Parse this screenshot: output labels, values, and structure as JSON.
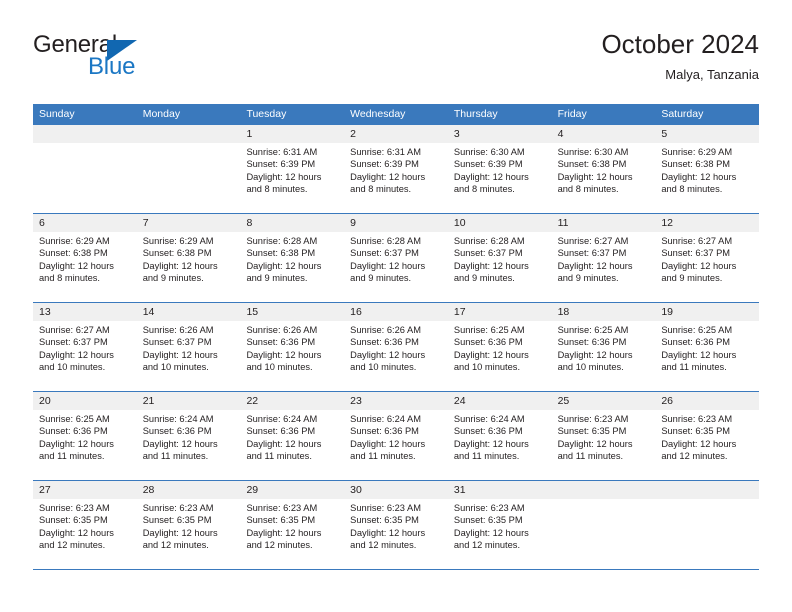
{
  "brand": {
    "name_top": "General",
    "name_bottom": "Blue",
    "top_color": "#231f20",
    "bottom_color": "#1b77c4",
    "triangle_color": "#1167b1"
  },
  "header": {
    "title": "October 2024",
    "subtitle": "Malya, Tanzania"
  },
  "theme": {
    "header_blue": "#3a79bd",
    "daterow_gray": "#f0f0f0",
    "text": "#231f20",
    "header_text": "#ffffff"
  },
  "weekdays": [
    "Sunday",
    "Monday",
    "Tuesday",
    "Wednesday",
    "Thursday",
    "Friday",
    "Saturday"
  ],
  "weeks": [
    {
      "days": [
        {
          "num": "",
          "sunrise": "",
          "sunset": "",
          "daylight1": "",
          "daylight2": ""
        },
        {
          "num": "",
          "sunrise": "",
          "sunset": "",
          "daylight1": "",
          "daylight2": ""
        },
        {
          "num": "1",
          "sunrise": "Sunrise: 6:31 AM",
          "sunset": "Sunset: 6:39 PM",
          "daylight1": "Daylight: 12 hours",
          "daylight2": "and 8 minutes."
        },
        {
          "num": "2",
          "sunrise": "Sunrise: 6:31 AM",
          "sunset": "Sunset: 6:39 PM",
          "daylight1": "Daylight: 12 hours",
          "daylight2": "and 8 minutes."
        },
        {
          "num": "3",
          "sunrise": "Sunrise: 6:30 AM",
          "sunset": "Sunset: 6:39 PM",
          "daylight1": "Daylight: 12 hours",
          "daylight2": "and 8 minutes."
        },
        {
          "num": "4",
          "sunrise": "Sunrise: 6:30 AM",
          "sunset": "Sunset: 6:38 PM",
          "daylight1": "Daylight: 12 hours",
          "daylight2": "and 8 minutes."
        },
        {
          "num": "5",
          "sunrise": "Sunrise: 6:29 AM",
          "sunset": "Sunset: 6:38 PM",
          "daylight1": "Daylight: 12 hours",
          "daylight2": "and 8 minutes."
        }
      ]
    },
    {
      "days": [
        {
          "num": "6",
          "sunrise": "Sunrise: 6:29 AM",
          "sunset": "Sunset: 6:38 PM",
          "daylight1": "Daylight: 12 hours",
          "daylight2": "and 8 minutes."
        },
        {
          "num": "7",
          "sunrise": "Sunrise: 6:29 AM",
          "sunset": "Sunset: 6:38 PM",
          "daylight1": "Daylight: 12 hours",
          "daylight2": "and 9 minutes."
        },
        {
          "num": "8",
          "sunrise": "Sunrise: 6:28 AM",
          "sunset": "Sunset: 6:38 PM",
          "daylight1": "Daylight: 12 hours",
          "daylight2": "and 9 minutes."
        },
        {
          "num": "9",
          "sunrise": "Sunrise: 6:28 AM",
          "sunset": "Sunset: 6:37 PM",
          "daylight1": "Daylight: 12 hours",
          "daylight2": "and 9 minutes."
        },
        {
          "num": "10",
          "sunrise": "Sunrise: 6:28 AM",
          "sunset": "Sunset: 6:37 PM",
          "daylight1": "Daylight: 12 hours",
          "daylight2": "and 9 minutes."
        },
        {
          "num": "11",
          "sunrise": "Sunrise: 6:27 AM",
          "sunset": "Sunset: 6:37 PM",
          "daylight1": "Daylight: 12 hours",
          "daylight2": "and 9 minutes."
        },
        {
          "num": "12",
          "sunrise": "Sunrise: 6:27 AM",
          "sunset": "Sunset: 6:37 PM",
          "daylight1": "Daylight: 12 hours",
          "daylight2": "and 9 minutes."
        }
      ]
    },
    {
      "days": [
        {
          "num": "13",
          "sunrise": "Sunrise: 6:27 AM",
          "sunset": "Sunset: 6:37 PM",
          "daylight1": "Daylight: 12 hours",
          "daylight2": "and 10 minutes."
        },
        {
          "num": "14",
          "sunrise": "Sunrise: 6:26 AM",
          "sunset": "Sunset: 6:37 PM",
          "daylight1": "Daylight: 12 hours",
          "daylight2": "and 10 minutes."
        },
        {
          "num": "15",
          "sunrise": "Sunrise: 6:26 AM",
          "sunset": "Sunset: 6:36 PM",
          "daylight1": "Daylight: 12 hours",
          "daylight2": "and 10 minutes."
        },
        {
          "num": "16",
          "sunrise": "Sunrise: 6:26 AM",
          "sunset": "Sunset: 6:36 PM",
          "daylight1": "Daylight: 12 hours",
          "daylight2": "and 10 minutes."
        },
        {
          "num": "17",
          "sunrise": "Sunrise: 6:25 AM",
          "sunset": "Sunset: 6:36 PM",
          "daylight1": "Daylight: 12 hours",
          "daylight2": "and 10 minutes."
        },
        {
          "num": "18",
          "sunrise": "Sunrise: 6:25 AM",
          "sunset": "Sunset: 6:36 PM",
          "daylight1": "Daylight: 12 hours",
          "daylight2": "and 10 minutes."
        },
        {
          "num": "19",
          "sunrise": "Sunrise: 6:25 AM",
          "sunset": "Sunset: 6:36 PM",
          "daylight1": "Daylight: 12 hours",
          "daylight2": "and 11 minutes."
        }
      ]
    },
    {
      "days": [
        {
          "num": "20",
          "sunrise": "Sunrise: 6:25 AM",
          "sunset": "Sunset: 6:36 PM",
          "daylight1": "Daylight: 12 hours",
          "daylight2": "and 11 minutes."
        },
        {
          "num": "21",
          "sunrise": "Sunrise: 6:24 AM",
          "sunset": "Sunset: 6:36 PM",
          "daylight1": "Daylight: 12 hours",
          "daylight2": "and 11 minutes."
        },
        {
          "num": "22",
          "sunrise": "Sunrise: 6:24 AM",
          "sunset": "Sunset: 6:36 PM",
          "daylight1": "Daylight: 12 hours",
          "daylight2": "and 11 minutes."
        },
        {
          "num": "23",
          "sunrise": "Sunrise: 6:24 AM",
          "sunset": "Sunset: 6:36 PM",
          "daylight1": "Daylight: 12 hours",
          "daylight2": "and 11 minutes."
        },
        {
          "num": "24",
          "sunrise": "Sunrise: 6:24 AM",
          "sunset": "Sunset: 6:36 PM",
          "daylight1": "Daylight: 12 hours",
          "daylight2": "and 11 minutes."
        },
        {
          "num": "25",
          "sunrise": "Sunrise: 6:23 AM",
          "sunset": "Sunset: 6:35 PM",
          "daylight1": "Daylight: 12 hours",
          "daylight2": "and 11 minutes."
        },
        {
          "num": "26",
          "sunrise": "Sunrise: 6:23 AM",
          "sunset": "Sunset: 6:35 PM",
          "daylight1": "Daylight: 12 hours",
          "daylight2": "and 12 minutes."
        }
      ]
    },
    {
      "days": [
        {
          "num": "27",
          "sunrise": "Sunrise: 6:23 AM",
          "sunset": "Sunset: 6:35 PM",
          "daylight1": "Daylight: 12 hours",
          "daylight2": "and 12 minutes."
        },
        {
          "num": "28",
          "sunrise": "Sunrise: 6:23 AM",
          "sunset": "Sunset: 6:35 PM",
          "daylight1": "Daylight: 12 hours",
          "daylight2": "and 12 minutes."
        },
        {
          "num": "29",
          "sunrise": "Sunrise: 6:23 AM",
          "sunset": "Sunset: 6:35 PM",
          "daylight1": "Daylight: 12 hours",
          "daylight2": "and 12 minutes."
        },
        {
          "num": "30",
          "sunrise": "Sunrise: 6:23 AM",
          "sunset": "Sunset: 6:35 PM",
          "daylight1": "Daylight: 12 hours",
          "daylight2": "and 12 minutes."
        },
        {
          "num": "31",
          "sunrise": "Sunrise: 6:23 AM",
          "sunset": "Sunset: 6:35 PM",
          "daylight1": "Daylight: 12 hours",
          "daylight2": "and 12 minutes."
        },
        {
          "num": "",
          "sunrise": "",
          "sunset": "",
          "daylight1": "",
          "daylight2": ""
        },
        {
          "num": "",
          "sunrise": "",
          "sunset": "",
          "daylight1": "",
          "daylight2": ""
        }
      ]
    }
  ]
}
